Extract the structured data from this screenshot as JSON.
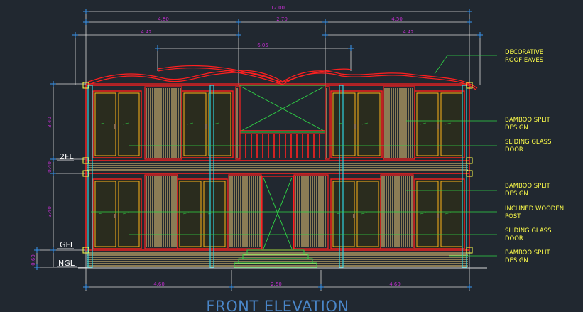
{
  "drawing": {
    "title": "FRONT ELEVATION",
    "colors": {
      "background": "#212830",
      "frame": "#ff2020",
      "bamboo": "#f5d17a",
      "glass": "#ffb319",
      "post": "#2fd4e0",
      "leader": "#2fd646",
      "dimension": "#d8d8d8",
      "dimension_text": "#c22fd0",
      "annotation": "#ffff4a"
    }
  },
  "dimensions": {
    "top_overall": "12.00",
    "top_left": "4.80",
    "top_mid": "2.70",
    "top_right": "4.50",
    "second_left": "4.42",
    "second_right": "4.42",
    "third_mid": "6.05",
    "bottom_left": "4.60",
    "bottom_mid": "2.50",
    "bottom_right": "4.60",
    "v_upper": "3.40",
    "v_floor": "0.40",
    "v_lower": "3.40",
    "v_plinth": "0.60"
  },
  "levels": {
    "second_floor": "2FL",
    "ground_floor": "GFL",
    "natural_ground": "NGL"
  },
  "annotations": {
    "roof_eaves": [
      "DECORATIVE",
      "ROOF EAVES"
    ],
    "bamboo_upper": [
      "BAMBOO SPLIT",
      "DESIGN"
    ],
    "glass_upper": [
      "SLIDING GLASS",
      "DOOR"
    ],
    "bamboo_mid": [
      "BAMBOO SPLIT",
      "DESIGN"
    ],
    "wooden_post": [
      "INCLINED WOODEN",
      "POST"
    ],
    "glass_lower": [
      "SLIDING GLASS",
      "DOOR"
    ],
    "bamboo_lower": [
      "BAMBOO SPLIT",
      "DESIGN"
    ]
  }
}
